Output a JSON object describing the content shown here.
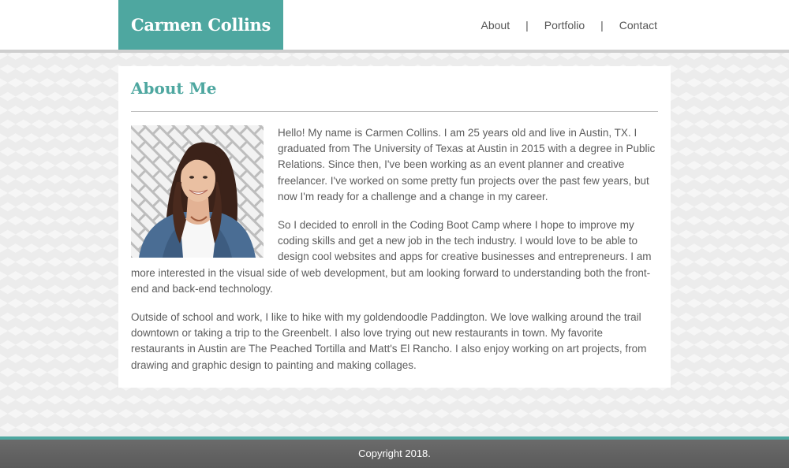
{
  "header": {
    "brand": "Carmen Collins",
    "nav": [
      {
        "label": "About"
      },
      {
        "label": "Portfolio"
      },
      {
        "label": "Contact"
      }
    ],
    "separator": "|"
  },
  "main": {
    "title": "About Me",
    "photo_alt": "profile photo",
    "paragraphs": [
      "Hello! My name is Carmen Collins. I am 25 years old and live in Austin, TX. I graduated from The University of Texas at Austin in 2015 with a degree in Public Relations. Since then, I've been working as an event planner and creative freelancer. I've worked on some pretty fun projects over the past few years, but now I'm ready for a challenge and a change in my career.",
      "So I decided to enroll in the Coding Boot Camp where I hope to improve my coding skills and get a new job in the tech industry. I would love to be able to design cool websites and apps for creative businesses and entrepreneurs. I am more interested in the visual side of web development, but am looking forward to understanding both the front-end and back-end technology.",
      "Outside of school and work, I like to hike with my goldendoodle Paddington. We love walking around the trail downtown or taking a trip to the Greenbelt. I also love trying out new restaurants in town. My favorite restaurants in Austin are The Peached Tortilla and Matt's El Rancho. I also enjoy working on art projects, from drawing and graphic design to painting and making collages."
    ]
  },
  "footer": {
    "copyright": "Copyright 2018."
  },
  "colors": {
    "accent": "#4ea7a0",
    "footer_bg": "#5f5f5f",
    "text": "#5d5d5d"
  }
}
